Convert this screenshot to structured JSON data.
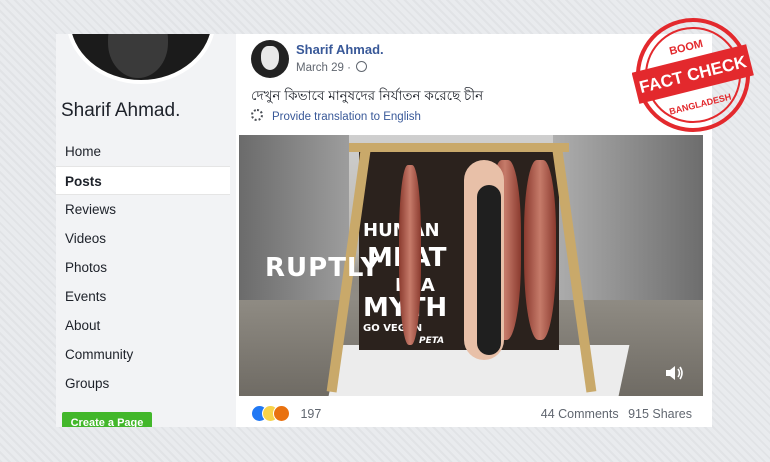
{
  "sidebar": {
    "page_name": "Sharif Ahmad.",
    "nav": [
      "Home",
      "Posts",
      "Reviews",
      "Videos",
      "Photos",
      "Events",
      "About",
      "Community",
      "Groups"
    ],
    "active_item": "Posts",
    "create_page_label": "Create a Page"
  },
  "post": {
    "author": "Sharif Ahmad.",
    "date": "March 29 ·",
    "text": "দেখুন কিভাবে মানুষদের নির্যাতন করেছে চীন",
    "translate_link": "Provide translation to English",
    "video": {
      "banner_line1": "HUMAN",
      "banner_line2": "MEAT",
      "banner_line3": "IS A",
      "banner_line4": "MYTH",
      "banner_line5": "GO VEGAN",
      "banner_line6": "PETA",
      "watermark": "RUPTLY"
    },
    "reaction_count": "197",
    "comments": "44 Comments",
    "shares": "915 Shares"
  },
  "stamp": {
    "top": "BOOM",
    "middle": "FACT CHECK",
    "bottom": "BANGLADESH",
    "color": "#e3292d"
  }
}
